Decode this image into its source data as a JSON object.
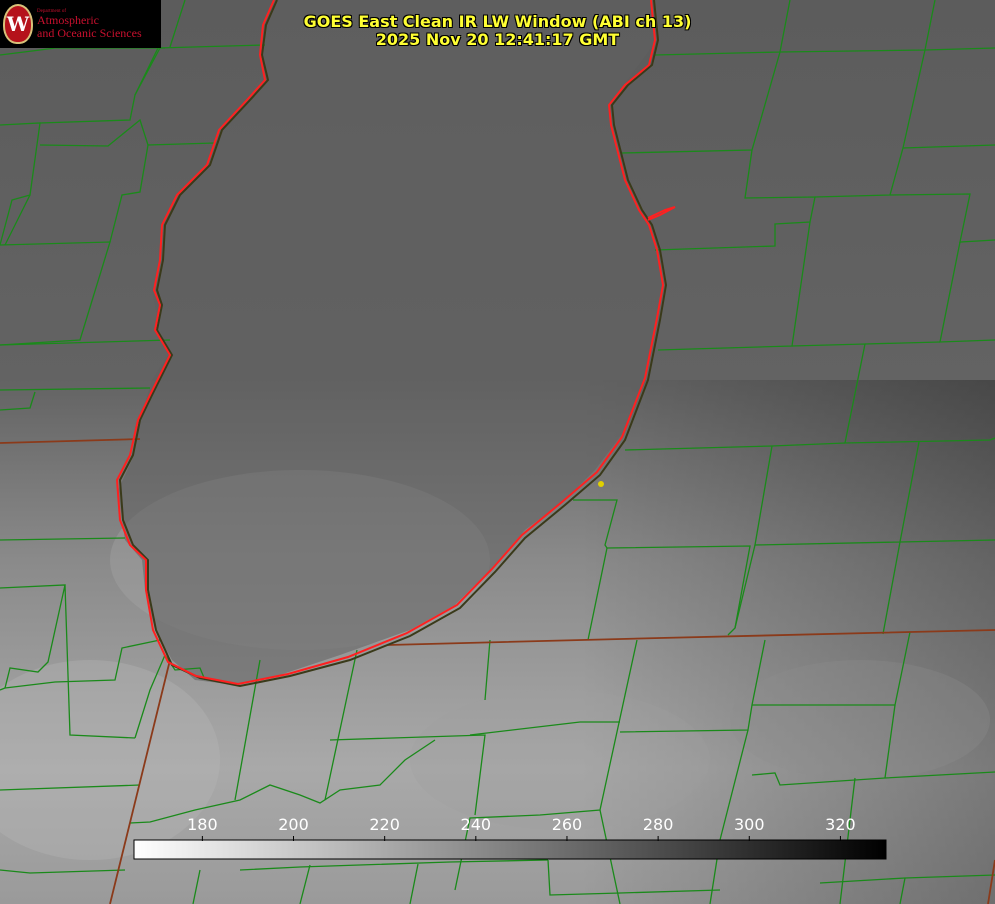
{
  "logo": {
    "department_label": "Department of",
    "line1": "Atmospheric",
    "line2": "and Oceanic Sciences",
    "seal_letter": "W"
  },
  "title": {
    "line1": "GOES East Clean IR LW Window (ABI ch 13)",
    "line2": "2025 Nov 20 12:41:17 GMT"
  },
  "colorbar": {
    "ticks": [
      "180",
      "200",
      "220",
      "240",
      "260",
      "280",
      "300",
      "320"
    ],
    "min_value": 165,
    "max_value": 330,
    "low_color": "#ffffff",
    "high_color": "#000000"
  },
  "colors": {
    "coastline": "#ff2020",
    "county_lines": "#1a8a1a",
    "state_lines": "#8b3a1a",
    "marker": "#e0d000",
    "title_text": "#ffff33"
  }
}
